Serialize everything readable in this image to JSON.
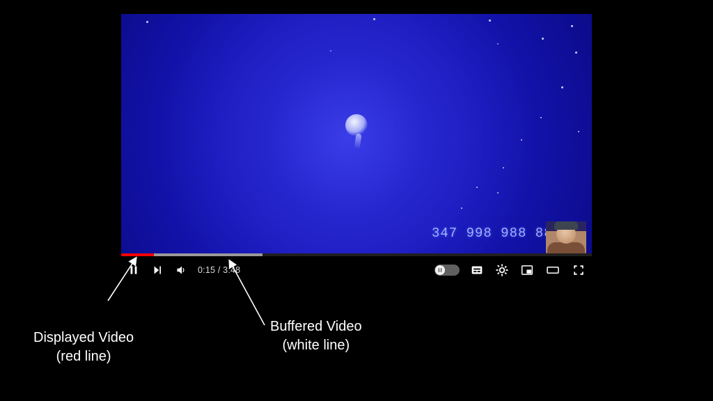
{
  "video": {
    "overlay_number": "347 998 988 888"
  },
  "player": {
    "played_percent": 7,
    "buffered_percent": 30,
    "current_time": "0:15",
    "duration": "3:48",
    "time_separator": " / "
  },
  "icons": {
    "pause": "pause-icon",
    "next": "next-icon",
    "volume": "volume-icon",
    "autoplay": "autoplay-toggle",
    "subtitles": "subtitles-icon",
    "settings": "gear-icon",
    "miniplayer": "miniplayer-icon",
    "theater": "theater-icon",
    "fullscreen": "fullscreen-icon"
  },
  "annotations": {
    "displayed": {
      "line1": "Displayed Video",
      "line2": "(red line)"
    },
    "buffered": {
      "line1": "Buffered Video",
      "line2": "(white line)"
    }
  }
}
